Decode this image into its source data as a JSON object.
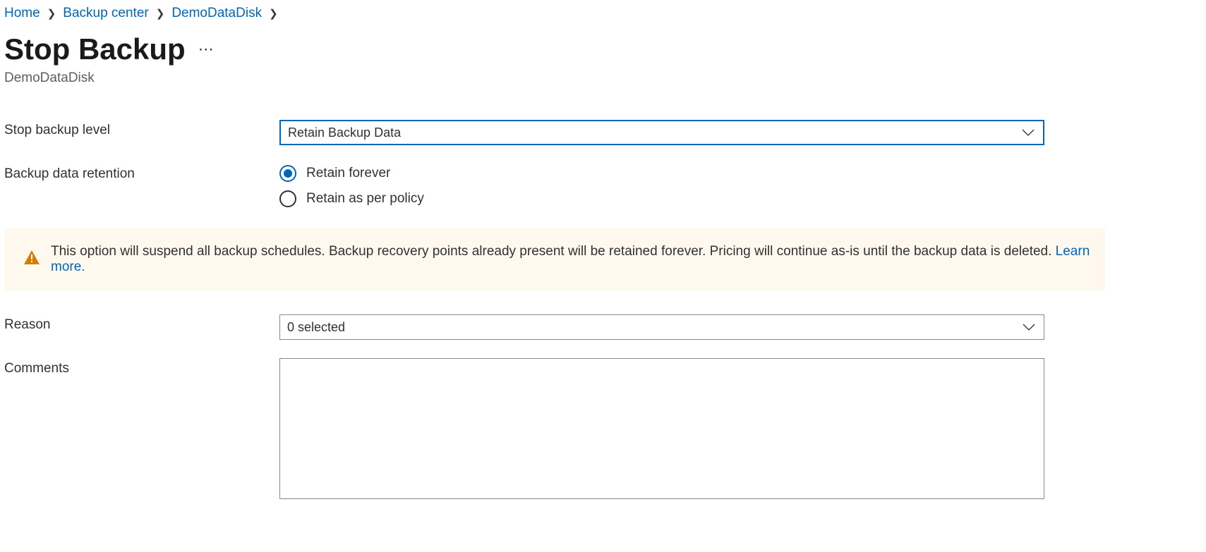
{
  "breadcrumb": {
    "items": [
      {
        "label": "Home"
      },
      {
        "label": "Backup center"
      },
      {
        "label": "DemoDataDisk"
      }
    ]
  },
  "header": {
    "title": "Stop Backup",
    "subtitle": "DemoDataDisk"
  },
  "stop_level": {
    "label": "Stop backup level",
    "selected": "Retain Backup Data"
  },
  "retention": {
    "label": "Backup data retention",
    "options": [
      {
        "label": "Retain forever",
        "selected": true
      },
      {
        "label": "Retain as per policy",
        "selected": false
      }
    ]
  },
  "banner": {
    "text": "This option will suspend all backup schedules. Backup recovery points already present will be retained forever. Pricing will continue as-is until the backup data is deleted. ",
    "link": "Learn more."
  },
  "reason": {
    "label": "Reason",
    "selected": "0 selected"
  },
  "comments": {
    "label": "Comments",
    "value": ""
  }
}
